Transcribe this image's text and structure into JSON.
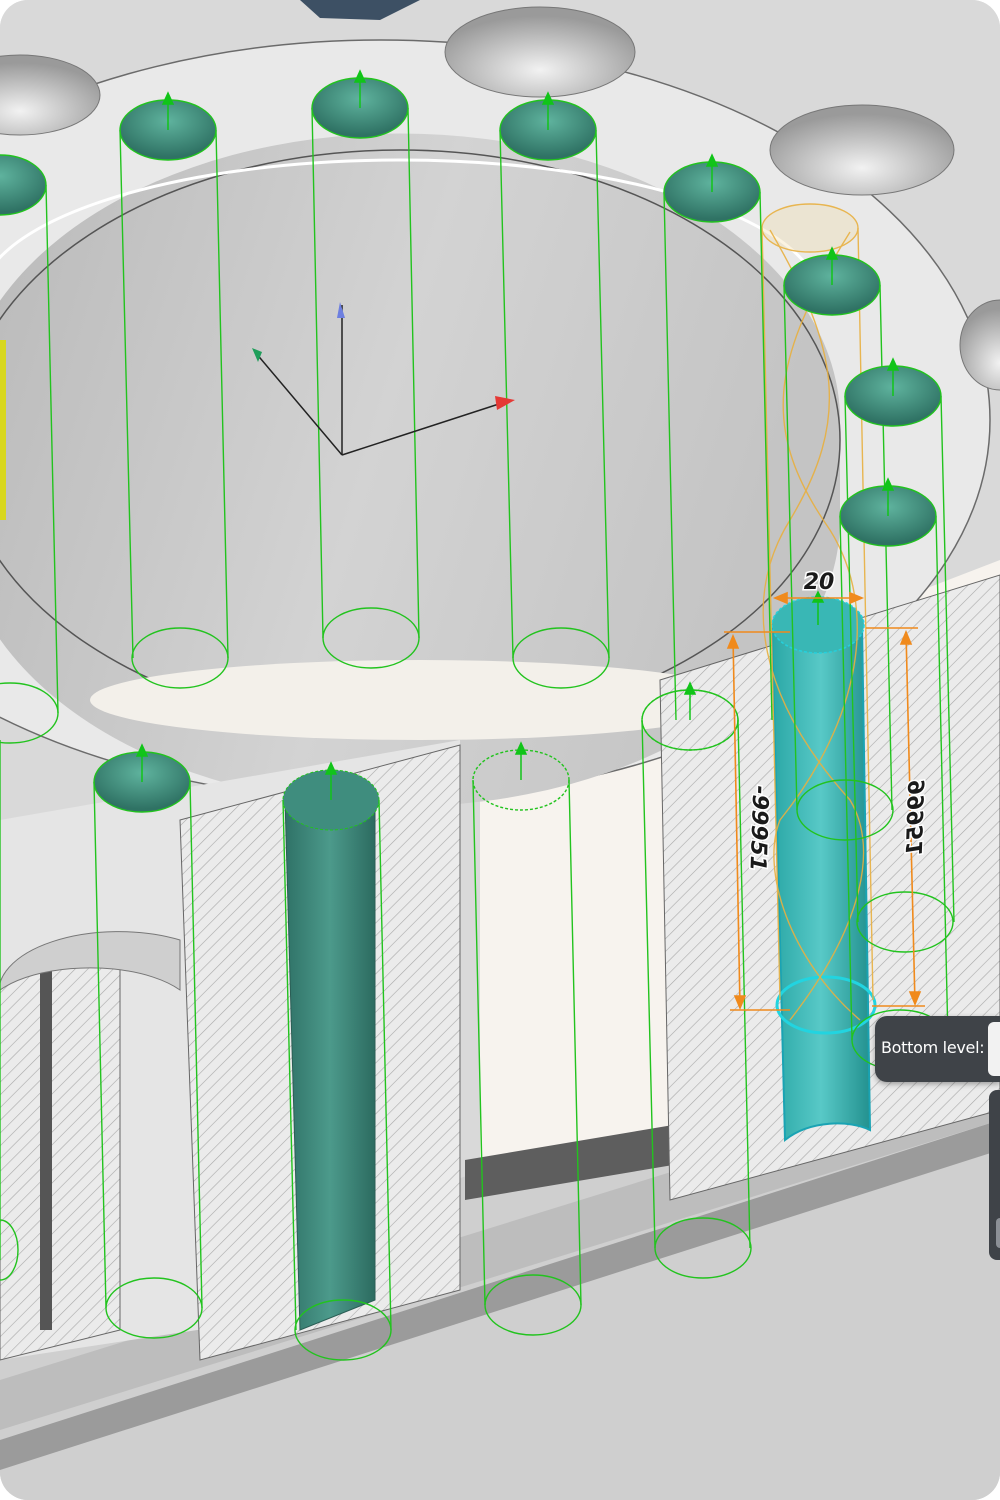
{
  "viewport": {
    "dimension_width_value": "20",
    "dimension_left_value": "-99951",
    "dimension_right_value": "99951"
  },
  "hud": {
    "label": "Bottom level:",
    "value": ""
  },
  "colors": {
    "hole_outline": "#22c31e",
    "selected_hole": "#2fb7b6",
    "dimension": "#f08a1c",
    "preview_helix": "#e8b040",
    "hud_background": "#3f4348",
    "axis_x": "#e53935",
    "axis_y": "#1f9e5a",
    "axis_z": "#6d7fe0"
  },
  "icons": {
    "hole_direction": "green-arrow-icon",
    "triad": "coordinate-axes-icon"
  }
}
